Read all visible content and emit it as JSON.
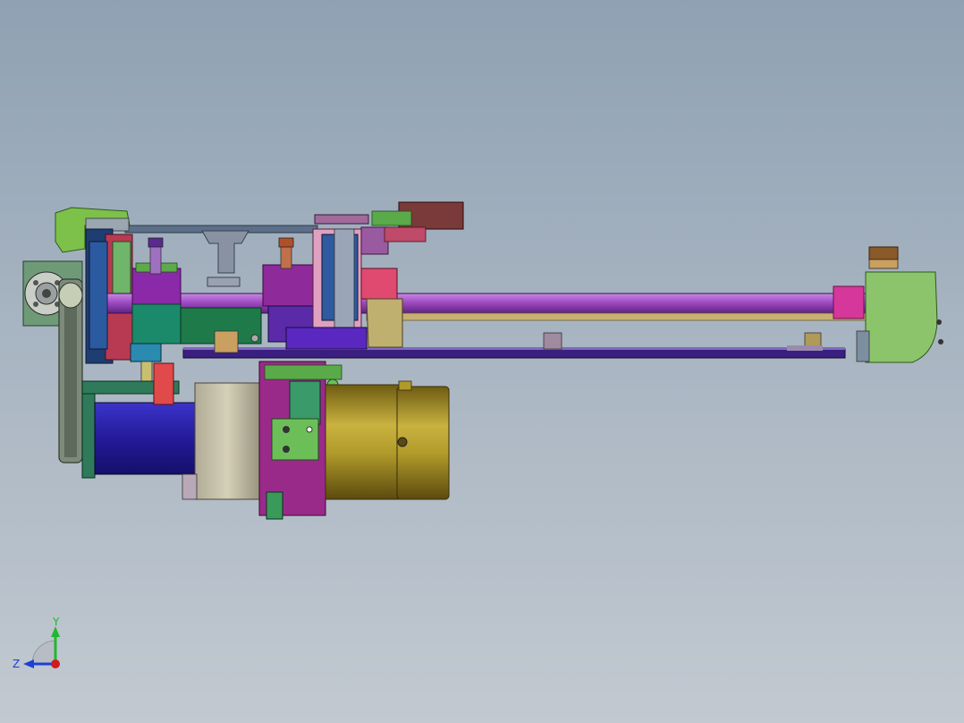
{
  "triad": {
    "y_label": "Y",
    "z_label": "Z",
    "colors": {
      "y": "#1fb832",
      "z": "#1d3fd6",
      "x": "#d11a1a"
    }
  },
  "colors": {
    "background_top": "#8fa1b3",
    "background_bottom": "#c2c9d1",
    "shaft": "#a04bc4",
    "motor_body": "#2a1fa0",
    "gear_motor": "#b09a2a",
    "bracket_green": "#8cc46b"
  }
}
